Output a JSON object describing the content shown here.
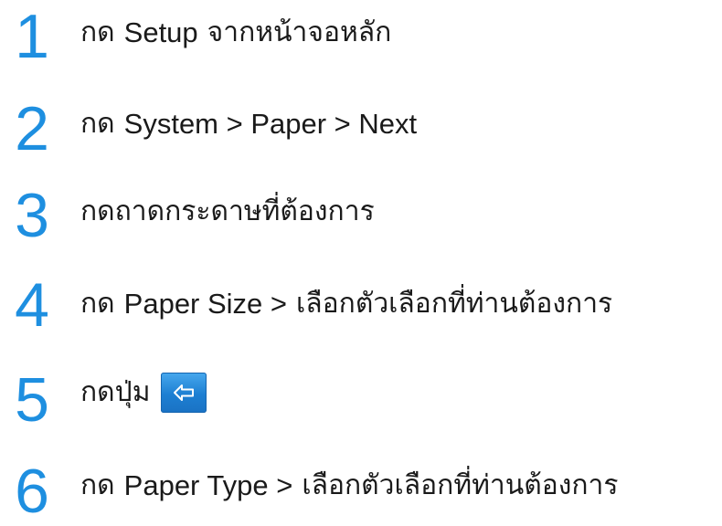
{
  "steps": [
    {
      "number": "1",
      "prefix": "กด",
      "key": "Setup",
      "middle": "จากหน้าจอ",
      "suffix": "หลัก"
    },
    {
      "number": "2",
      "prefix": "กด",
      "key": "System > Paper > Next"
    },
    {
      "number": "3",
      "prefix": "กดถาดกระดาษที่ต้องการ"
    },
    {
      "number": "4",
      "prefix": "กด",
      "key": "Paper Size >",
      "suffix": "เลือกตัวเลือกที่ท่านต้องการ"
    },
    {
      "number": "5",
      "prefix": "กดปุ่ม",
      "icon": "back-arrow-icon"
    },
    {
      "number": "6",
      "prefix": "กด",
      "key": "Paper Type >",
      "suffix": "เลือกตัวเลือกที่ท่านต้องการ"
    }
  ],
  "colors": {
    "accent": "#1e8fe0",
    "button": "#1d7fd2"
  }
}
